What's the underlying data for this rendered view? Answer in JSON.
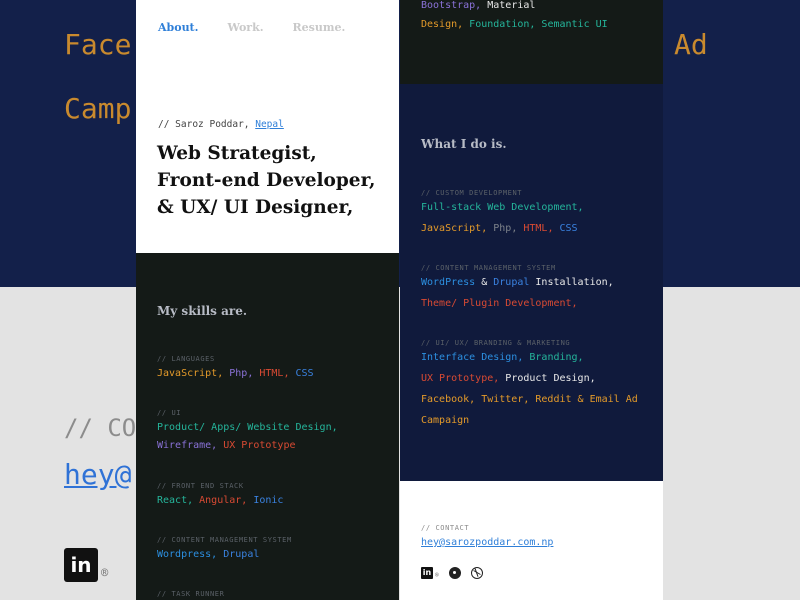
{
  "background": {
    "line1_left": "Face",
    "line1_right": "Ad",
    "line2": "Camp",
    "contact_label": "// CO",
    "email_fragment": "hey@",
    "linkedin_glyph": "in",
    "reg_mark": "®"
  },
  "nav": {
    "items": [
      {
        "label": "About.",
        "active": true
      },
      {
        "label": "Work.",
        "active": false
      },
      {
        "label": "Resume.",
        "active": false
      }
    ]
  },
  "intro": {
    "byline_prefix": "// Saroz Poddar, ",
    "location": "Nepal",
    "headline": [
      "Web Strategist,",
      "Front-end Developer,",
      "& UX/ UI Designer,"
    ]
  },
  "skills": {
    "title": "My skills are.",
    "groups": [
      {
        "label": "// LANGUAGES",
        "lines": [
          [
            [
              "JavaScript,",
              "orange"
            ],
            [
              " Php,",
              "purple"
            ],
            [
              " HTML,",
              "red"
            ],
            [
              " CSS",
              "blue"
            ]
          ]
        ]
      },
      {
        "label": "// UI",
        "lines": [
          [
            [
              "Product/ Apps/ Website Design,",
              "teal"
            ]
          ],
          [
            [
              "Wireframe,",
              "purple"
            ],
            [
              " UX Prototype",
              "red"
            ]
          ]
        ]
      },
      {
        "label": "// FRONT END STACK",
        "lines": [
          [
            [
              "React,",
              "teal"
            ],
            [
              " Angular,",
              "red"
            ],
            [
              " Ionic",
              "blue"
            ]
          ]
        ]
      },
      {
        "label": "// CONTENT MANAGEMENT SYSTEM",
        "lines": [
          [
            [
              "Wordpress,",
              "dkblue"
            ],
            [
              " Drupal",
              "blue"
            ]
          ]
        ]
      },
      {
        "label": "// TASK RUNNER",
        "lines": []
      }
    ]
  },
  "top_right": {
    "lines": [
      [
        [
          "Bootstrap,",
          "purple"
        ],
        [
          " Material",
          "white"
        ]
      ],
      [
        [
          "Design,",
          "orange"
        ],
        [
          " Foundation,",
          "teal"
        ],
        [
          " Semantic UI",
          "teal"
        ]
      ]
    ]
  },
  "what_i_do": {
    "title": "What I do is.",
    "groups": [
      {
        "label": "// CUSTOM DEVELOPMENT",
        "lines": [
          [
            [
              "Full-stack Web Development,",
              "teal"
            ]
          ],
          [
            [
              "JavaScript,",
              "orange"
            ],
            [
              " Php,",
              "grey"
            ],
            [
              " HTML,",
              "red"
            ],
            [
              " CSS",
              "blue"
            ]
          ]
        ]
      },
      {
        "label": "// CONTENT MANAGEMENT SYSTEM",
        "lines": [
          [
            [
              "WordPress",
              "dkblue"
            ],
            [
              " &",
              "white"
            ],
            [
              " Drupal",
              "blue"
            ],
            [
              " Installation,",
              "white"
            ]
          ],
          [
            [
              "Theme/ Plugin Development,",
              "red"
            ]
          ]
        ]
      },
      {
        "label": "// UI/ UX/ BRANDING & MARKETING",
        "lines": [
          [
            [
              "Interface Design,",
              "dkblue"
            ],
            [
              " Branding,",
              "teal"
            ]
          ],
          [
            [
              "UX Prototype,",
              "red"
            ],
            [
              " Product Design,",
              "white"
            ]
          ],
          [
            [
              "Facebook,",
              "orange"
            ],
            [
              " Twitter,",
              "orange"
            ],
            [
              " Reddit & Email Ad",
              "orange"
            ]
          ],
          [
            [
              "Campaign",
              "orange"
            ]
          ]
        ]
      }
    ]
  },
  "contact": {
    "label": "// CONTACT",
    "email": "hey@sarozpoddar.com.np",
    "social": [
      "linkedin-icon",
      "github-icon",
      "dribbble-icon"
    ]
  },
  "colors": {
    "orange": "#e39a2a",
    "purple": "#8a72d8",
    "red": "#d84a33",
    "blue": "#3a82e0",
    "teal": "#25b59b",
    "white": "#e8e8e8",
    "grey": "#7d828a",
    "dkblue": "#2c8fe0"
  }
}
